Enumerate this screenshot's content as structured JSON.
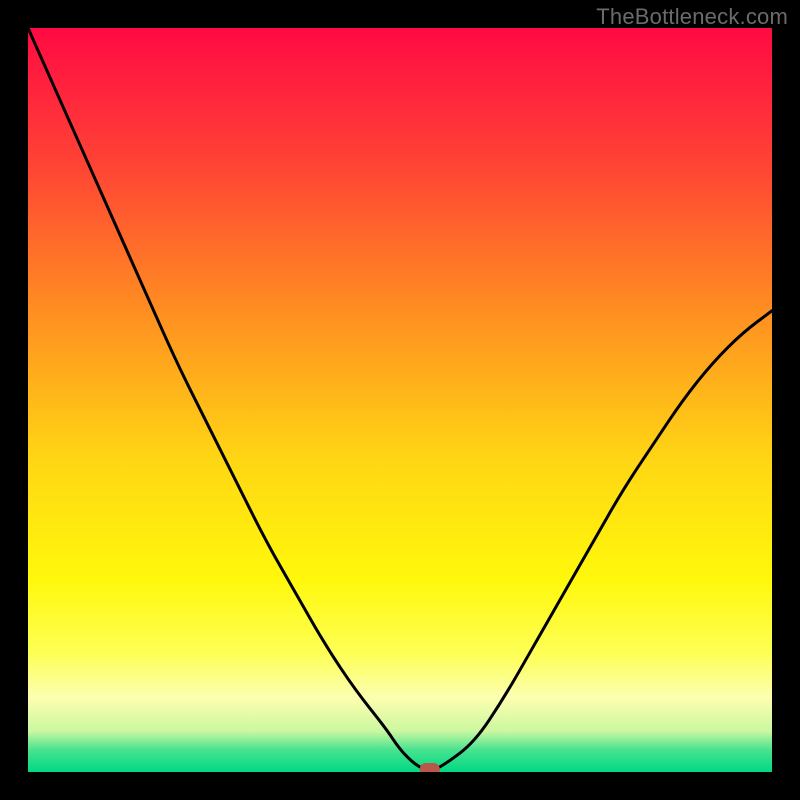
{
  "watermark": "TheBottleneck.com",
  "chart_data": {
    "type": "line",
    "title": "",
    "xlabel": "",
    "ylabel": "",
    "xlim": [
      0,
      100
    ],
    "ylim": [
      0,
      100
    ],
    "grid": false,
    "legend": false,
    "background_gradient_stops": [
      {
        "offset": 0.0,
        "color": "#ff0a43"
      },
      {
        "offset": 0.18,
        "color": "#ff4235"
      },
      {
        "offset": 0.38,
        "color": "#ff8e21"
      },
      {
        "offset": 0.58,
        "color": "#ffd614"
      },
      {
        "offset": 0.74,
        "color": "#fff80b"
      },
      {
        "offset": 0.84,
        "color": "#fdff55"
      },
      {
        "offset": 0.9,
        "color": "#fcffb0"
      },
      {
        "offset": 0.945,
        "color": "#ccf7a0"
      },
      {
        "offset": 0.97,
        "color": "#49e38f"
      },
      {
        "offset": 1.0,
        "color": "#00d884"
      }
    ],
    "series": [
      {
        "name": "bottleneck-curve",
        "x": [
          0,
          4,
          8,
          12,
          16,
          20,
          24,
          28,
          32,
          36,
          40,
          44,
          48,
          50,
          52,
          54,
          56,
          60,
          64,
          68,
          72,
          76,
          80,
          84,
          88,
          92,
          96,
          100
        ],
        "y": [
          100,
          91,
          82,
          73,
          64,
          55,
          47,
          39,
          31,
          24,
          17,
          11,
          6,
          3,
          1,
          0,
          1,
          4,
          10,
          17,
          24,
          31,
          38,
          44,
          50,
          55,
          59,
          62
        ]
      }
    ],
    "marker": {
      "x": 54,
      "y": 0,
      "color": "#b9574b"
    }
  }
}
